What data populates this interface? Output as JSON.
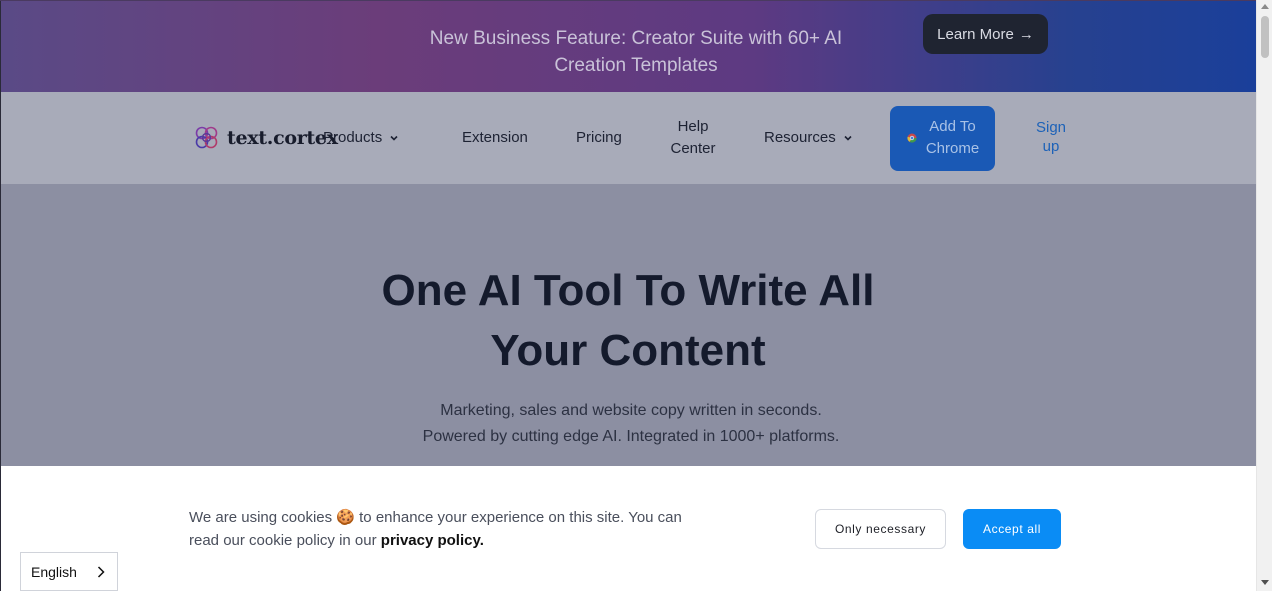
{
  "banner": {
    "text": "New Business Feature: Creator Suite with 60+ AI Creation Templates",
    "cta_label": "Learn More",
    "cta_arrow": "→"
  },
  "nav": {
    "logo_text": "text.cortex",
    "products_label": "Products",
    "extension_label": "Extension",
    "pricing_label": "Pricing",
    "help_center_label": "Help Center",
    "resources_label": "Resources",
    "add_to_chrome_label": "Add To Chrome",
    "signup_label": "Sign up"
  },
  "hero": {
    "title": "One AI Tool To Write All Your Content",
    "subtitle_line1": "Marketing, sales and website copy written in seconds.",
    "subtitle_line2": "Powered by cutting edge AI. Integrated in 1000+ platforms."
  },
  "cookie": {
    "text_before": "We are using cookies 🍪 to enhance your experience on this site. You can read our cookie policy in our ",
    "link_text": "privacy policy.",
    "only_necessary_label": "Only necessary",
    "accept_all_label": "Accept all"
  },
  "language": {
    "selected": "English"
  },
  "colors": {
    "accent_blue": "#0a8cf5",
    "chrome_button": "#1a59b5",
    "learn_more_button": "#1f2431"
  },
  "icons": {
    "logo": "brain-logo-icon",
    "nav_dropdown": "chevron-down-icon",
    "chrome": "chrome-icon",
    "language": "chevron-right-icon"
  }
}
